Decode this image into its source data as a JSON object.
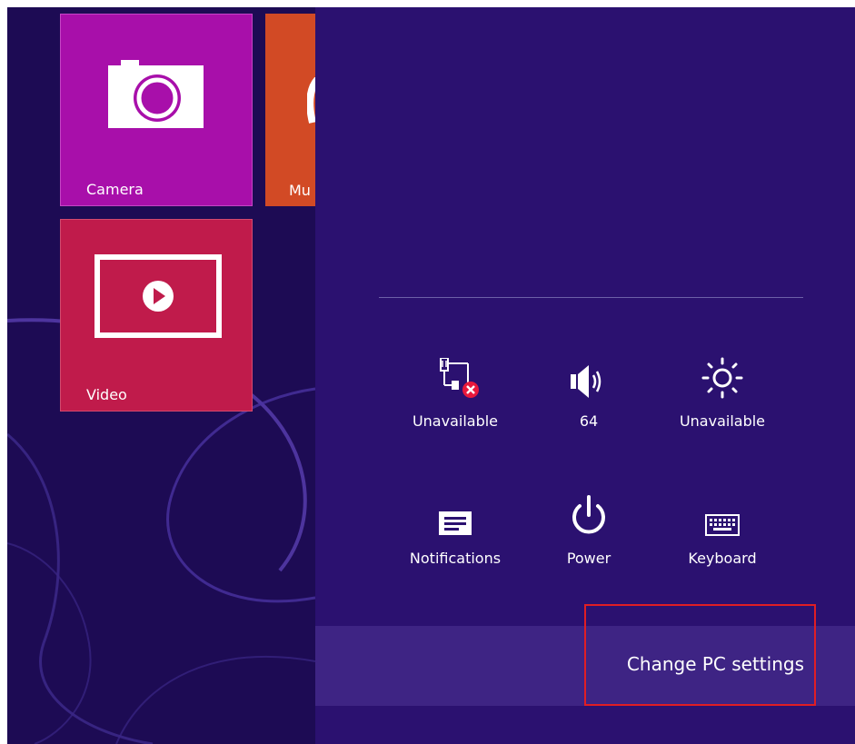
{
  "tiles": {
    "camera": {
      "label": "Camera",
      "icon": "camera-icon",
      "color": "#a80faa"
    },
    "music": {
      "label": "Mu",
      "icon": "headphones-icon",
      "color": "#d24a25"
    },
    "video": {
      "label": "Video",
      "icon": "video-play-icon",
      "color": "#c01b4b"
    }
  },
  "settings_charm": {
    "background": "#2b1170",
    "quick_settings": [
      {
        "label": "Unavailable",
        "icon": "network-unavailable-icon"
      },
      {
        "label": "64",
        "icon": "volume-icon"
      },
      {
        "label": "Unavailable",
        "icon": "brightness-icon"
      },
      {
        "label": "Notifications",
        "icon": "notifications-icon"
      },
      {
        "label": "Power",
        "icon": "power-icon"
      },
      {
        "label": "Keyboard",
        "icon": "keyboard-icon"
      }
    ],
    "change_pc_settings": "Change PC settings"
  },
  "highlight_color": "#e01e24"
}
